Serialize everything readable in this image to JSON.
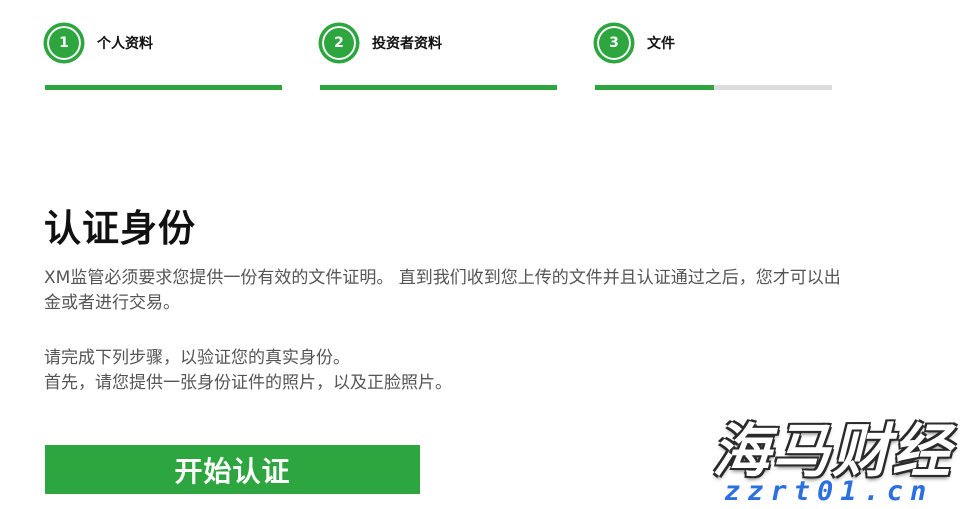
{
  "stepper": {
    "steps": [
      {
        "number": "1",
        "label": "个人资料",
        "progress": 1.0
      },
      {
        "number": "2",
        "label": "投资者资料",
        "progress": 1.0
      },
      {
        "number": "3",
        "label": "文件",
        "progress": 0.5
      }
    ]
  },
  "main": {
    "title": "认证身份",
    "description": "XM监管必须要求您提供一份有效的文件证明。 直到我们收到您上传的文件并且认证通过之后，您才可以出金或者进行交易。",
    "instructions_line1": "请完成下列步骤，以验证您的真实身份。",
    "instructions_line2": "首先，请您提供一张身份证件的照片，以及正脸照片。",
    "start_button": "开始认证"
  },
  "watermark": {
    "brand": "海马财经",
    "url": "zzrt01.cn"
  },
  "colors": {
    "accent": "#2ea640",
    "track": "#dcdcdc",
    "watermark_url": "#2b6fe0"
  }
}
